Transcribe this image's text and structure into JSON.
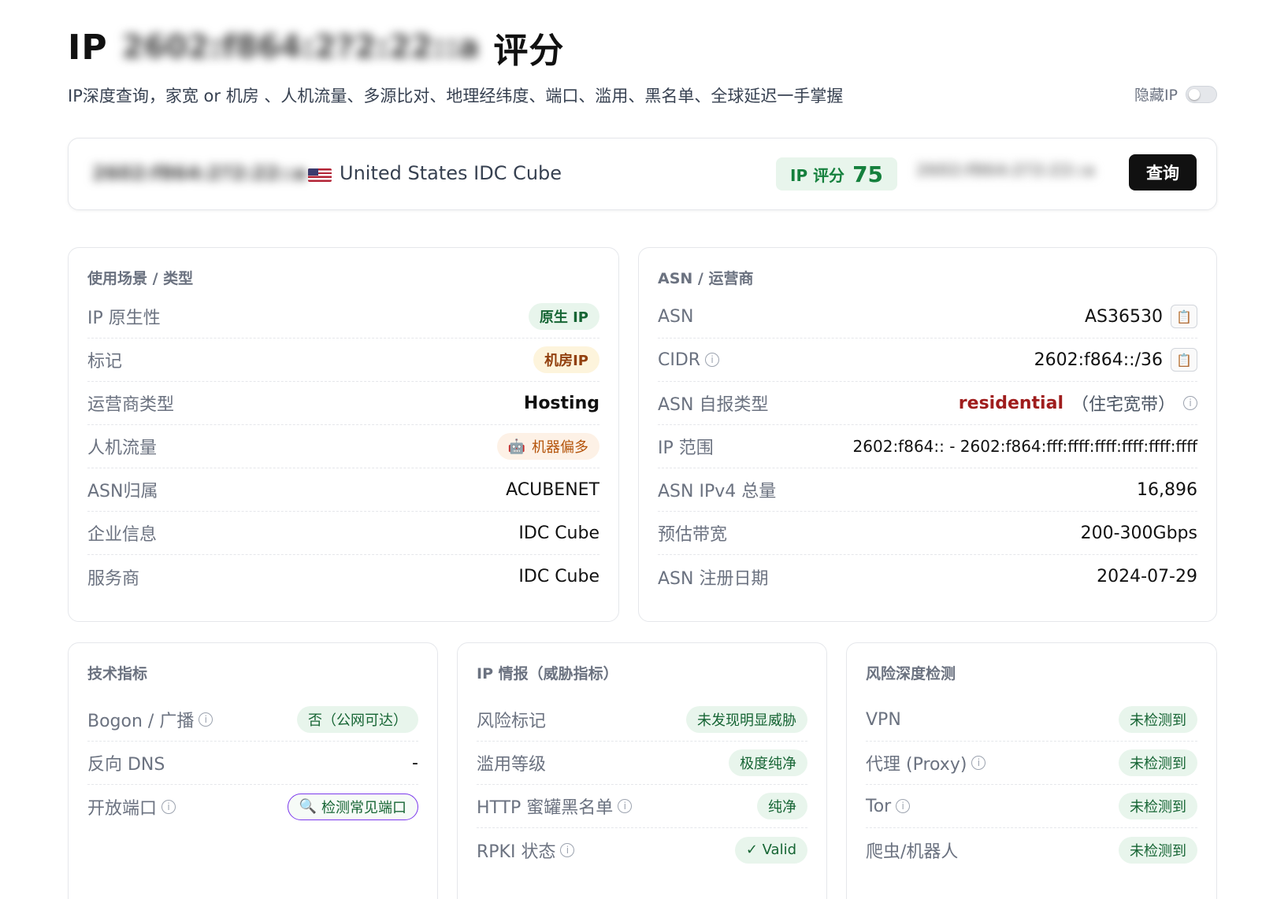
{
  "header": {
    "title_prefix": "IP",
    "title_ip": "2602:f864:2?2:22::a",
    "title_suffix": "评分",
    "subtitle": "IP深度查询，家宽 or 机房 、人机流量、多源比对、地理经纬度、端口、滥用、黑名单、全球延迟一手掌握",
    "hide_ip_label": "隐藏IP"
  },
  "search": {
    "ip_value": "2602:f864:2?2:22::a",
    "flag_icon": "us-flag-icon",
    "geo_text": "United States IDC Cube",
    "score_label": "IP 评分",
    "score_value": "75",
    "input_value": "2602:f864:2?2:22::a",
    "query_button": "查询"
  },
  "usage_card": {
    "title": "使用场景 / 类型",
    "rows": [
      {
        "label": "IP 原生性",
        "value": "原生 IP"
      },
      {
        "label": "标记",
        "value": "机房IP"
      },
      {
        "label": "运营商类型",
        "value": "Hosting"
      },
      {
        "label": "人机流量",
        "value": "机器偏多",
        "icon": "robot-icon"
      },
      {
        "label": "ASN归属",
        "value": "ACUBENET"
      },
      {
        "label": "企业信息",
        "value": "IDC Cube"
      },
      {
        "label": "服务商",
        "value": "IDC Cube"
      }
    ]
  },
  "asn_card": {
    "title": "ASN / 运营商",
    "rows": [
      {
        "label": "ASN",
        "value": "AS36530"
      },
      {
        "label": "CIDR",
        "value": "2602:f864::/36"
      },
      {
        "label": "ASN 自报类型",
        "value": "residential",
        "note": "（住宅宽带）"
      },
      {
        "label": "IP 范围",
        "value": "2602:f864:: - 2602:f864:fff:ffff:ffff:ffff:ffff:ffff"
      },
      {
        "label": "ASN IPv4 总量",
        "value": "16,896"
      },
      {
        "label": "预估带宽",
        "value": "200-300Gbps"
      },
      {
        "label": "ASN 注册日期",
        "value": "2024-07-29"
      }
    ]
  },
  "tech_card": {
    "title": "技术指标",
    "rows": [
      {
        "label": "Bogon / 广播",
        "value": "否（公网可达）"
      },
      {
        "label": "反向 DNS",
        "value": "-"
      },
      {
        "label": "开放端口",
        "value": "检测常见端口",
        "icon": "magnifier-icon"
      }
    ]
  },
  "intel_card": {
    "title": "IP 情报（威胁指标）",
    "rows": [
      {
        "label": "风险标记",
        "value": "未发现明显威胁"
      },
      {
        "label": "滥用等级",
        "value": "极度纯净"
      },
      {
        "label": "HTTP 蜜罐黑名单",
        "value": "纯净"
      },
      {
        "label": "RPKI 状态",
        "value": "✓ Valid"
      }
    ]
  },
  "risk_card": {
    "title": "风险深度检测",
    "rows": [
      {
        "label": "VPN",
        "value": "未检测到"
      },
      {
        "label": "代理 (Proxy)",
        "value": "未检测到"
      },
      {
        "label": "Tor",
        "value": "未检测到"
      },
      {
        "label": "爬虫/机器人",
        "value": "未检测到"
      }
    ]
  },
  "colors": {
    "accent_green": "#15803d",
    "badge_green_bg": "#e8f5ec",
    "badge_amber_bg": "#fdf4dc",
    "residential_red": "#9f1d1d",
    "button_black": "#111111"
  }
}
